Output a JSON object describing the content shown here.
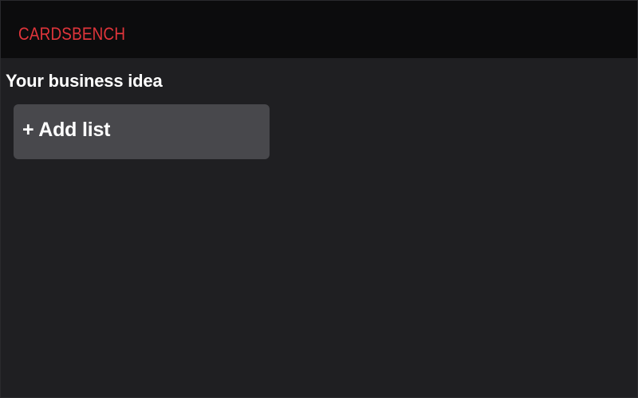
{
  "header": {
    "brand": "CARDSBENCH"
  },
  "board": {
    "title": "Your business idea",
    "add_list_label": "+ Add list"
  },
  "colors": {
    "page_bg": "#1f1f22",
    "header_bg": "#0c0c0d",
    "brand": "#e0353b",
    "add_list_bg": "#48484c"
  }
}
